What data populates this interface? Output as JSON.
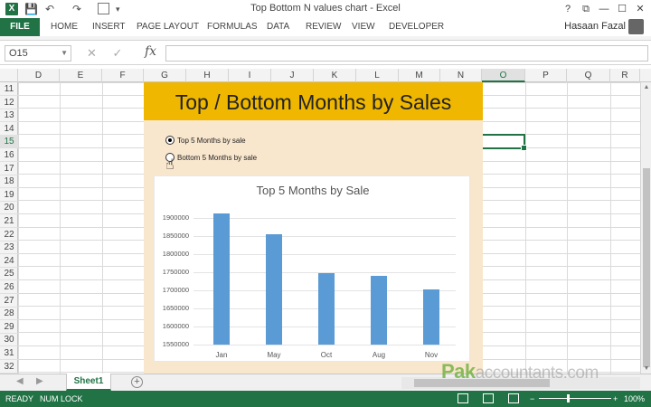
{
  "window": {
    "title": "Top Bottom N values chart - Excel",
    "controls": [
      "?",
      "⧉",
      "—",
      "☐",
      "✕"
    ]
  },
  "qat": {
    "save": "💾",
    "undo": "↶",
    "redo": "↷",
    "customize": "▾"
  },
  "ribbon": {
    "tabs": [
      "FILE",
      "HOME",
      "INSERT",
      "PAGE LAYOUT",
      "FORMULAS",
      "DATA",
      "REVIEW",
      "VIEW",
      "DEVELOPER"
    ],
    "user": "Hasaan Fazal"
  },
  "formula_bar": {
    "name_box": "O15",
    "fx": "fx",
    "value": ""
  },
  "grid": {
    "columns": [
      "D",
      "E",
      "F",
      "G",
      "H",
      "I",
      "J",
      "K",
      "L",
      "M",
      "N",
      "O",
      "P",
      "Q",
      "R"
    ],
    "rows": [
      "11",
      "12",
      "13",
      "14",
      "15",
      "16",
      "17",
      "18",
      "19",
      "20",
      "21",
      "22",
      "23",
      "24",
      "25",
      "26",
      "27",
      "28",
      "29",
      "30",
      "31",
      "32"
    ],
    "selected_column": "O",
    "selected_row": "15"
  },
  "dashboard": {
    "banner": "Top / Bottom Months by Sales",
    "options": [
      {
        "label": "Top 5 Months by sale",
        "selected": true
      },
      {
        "label": "Bottom 5 Months by sale",
        "selected": false
      }
    ]
  },
  "chart_data": {
    "type": "bar",
    "title": "Top 5 Months by Sale",
    "categories": [
      "Jan",
      "May",
      "Oct",
      "Aug",
      "Nov"
    ],
    "values": [
      1913000,
      1856000,
      1747000,
      1740000,
      1703000
    ],
    "yticks": [
      "1900000",
      "1850000",
      "1800000",
      "1750000",
      "1700000",
      "1650000",
      "1600000",
      "1550000"
    ],
    "ylim": [
      1550000,
      1925000
    ],
    "color": "#5b9bd5",
    "grid": true
  },
  "sheets": {
    "tabs": [
      "Sheet1"
    ],
    "active": "Sheet1",
    "add": "+"
  },
  "watermark": {
    "brand": "Pak",
    "rest": "accountants.com"
  },
  "statusbar": {
    "ready": "READY",
    "numlock": "NUM LOCK",
    "zoom": "100%",
    "minus": "−",
    "plus": "+"
  }
}
